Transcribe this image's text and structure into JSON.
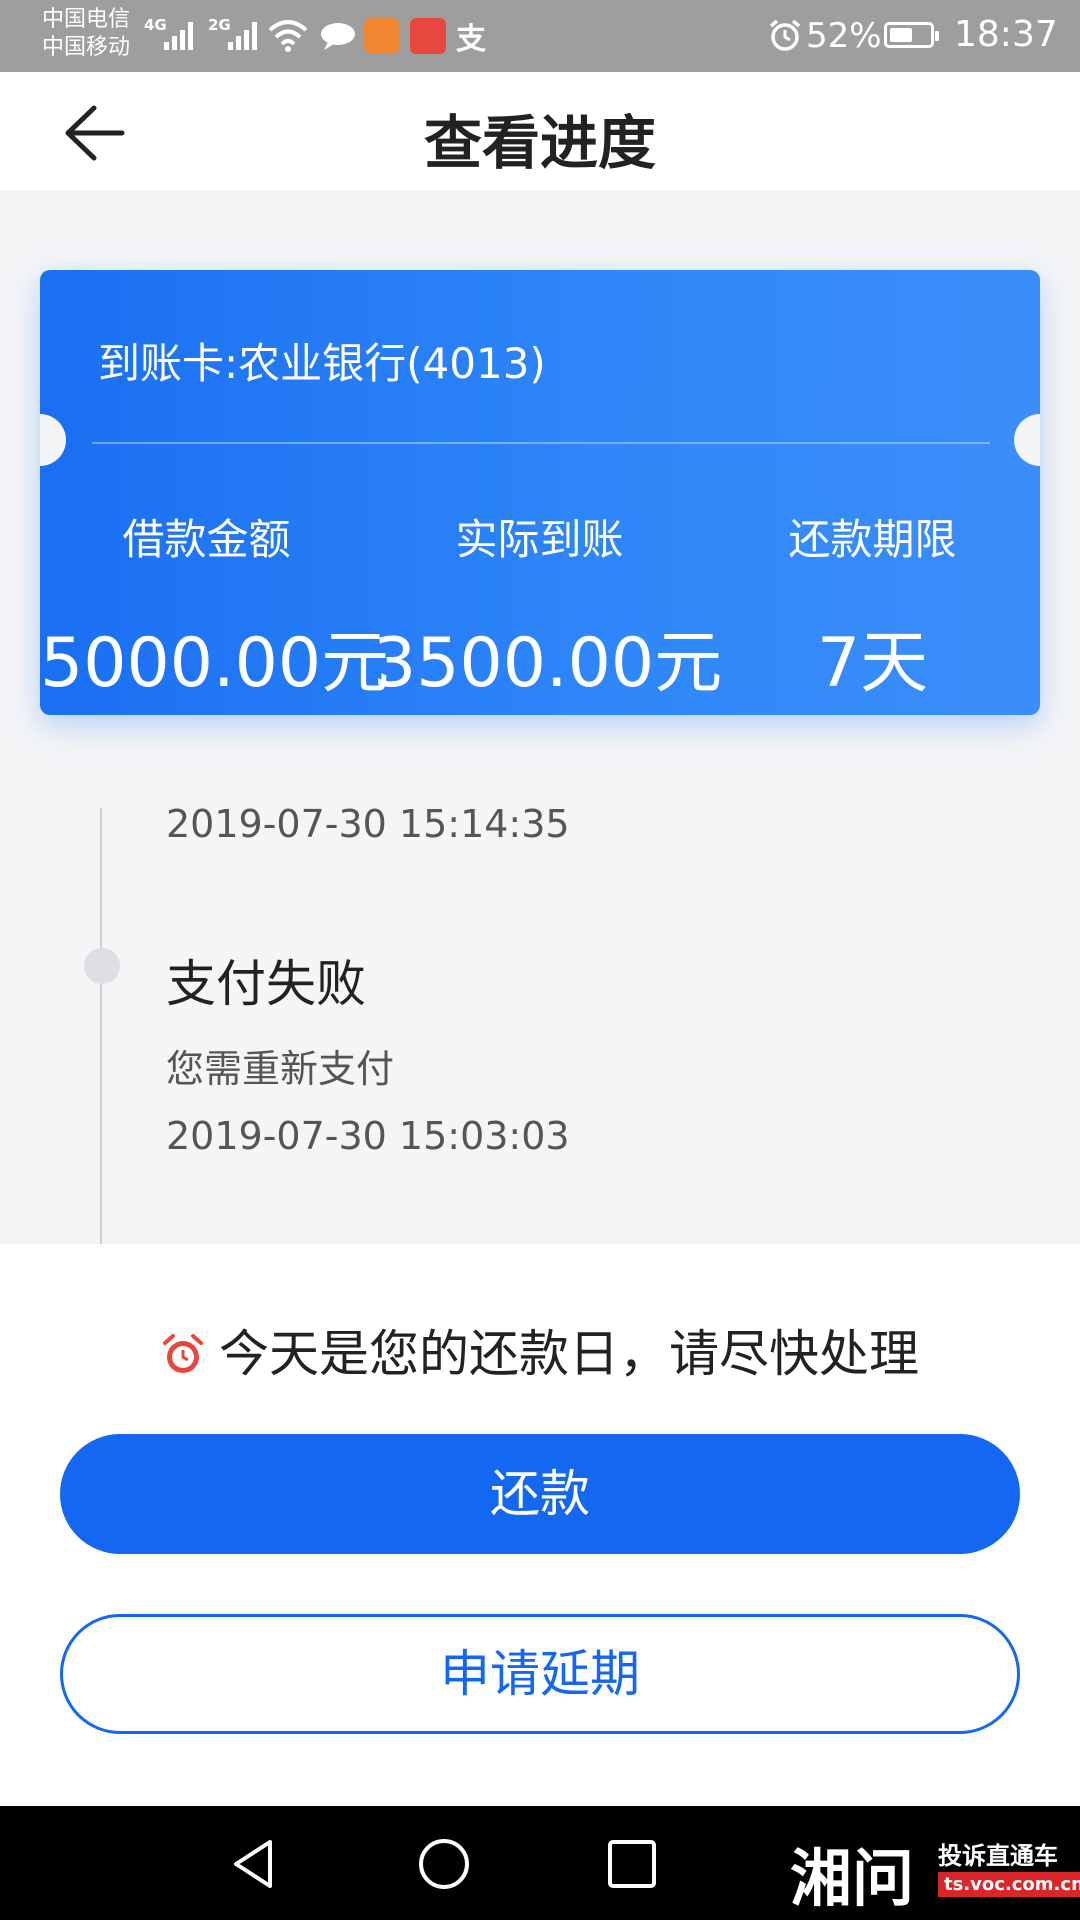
{
  "status_bar": {
    "carrier_1": "中国电信",
    "carrier_2": "中国移动",
    "network_1": "4G",
    "network_2": "2G",
    "alipay_glyph": "支",
    "battery": "52%",
    "time": "18:37",
    "icons": [
      "signal-icon",
      "wifi-icon",
      "chat-icon",
      "uc-browser-icon",
      "app-icon",
      "alipay-icon",
      "alarm-icon",
      "battery-icon"
    ]
  },
  "header": {
    "title": "查看进度",
    "back_icon": "arrow-left-icon"
  },
  "loan_card": {
    "bank": "到账卡:农业银行(4013)",
    "columns": [
      {
        "label": "借款金额",
        "value": "5000.00元"
      },
      {
        "label": "实际到账",
        "value": "3500.00元"
      },
      {
        "label": "还款期限",
        "value": "7天"
      }
    ],
    "colors": {
      "start": "#1a6ff2",
      "end": "#3b8ef9"
    }
  },
  "timeline": {
    "entry_1_time": "2019-07-30 15:14:35",
    "entry_2": {
      "status": "支付失败",
      "desc": "您需重新支付",
      "time": "2019-07-30 15:03:03"
    }
  },
  "notice": {
    "icon": "alarm-clock-icon",
    "text": "今天是您的还款日，请尽快处理"
  },
  "actions": {
    "repay_label": "还款",
    "extend_label": "申请延期",
    "accent": "#1467f0"
  },
  "nav_bar": {
    "icons": [
      "back-triangle-icon",
      "home-circle-icon",
      "recents-square-icon"
    ]
  },
  "watermark": {
    "brand": "湘问",
    "tagline": "投诉直通车",
    "url": "ts.voc.com.cn"
  }
}
